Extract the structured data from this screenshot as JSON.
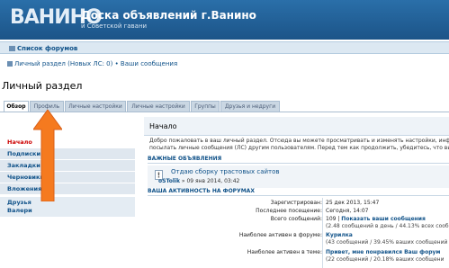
{
  "header": {
    "logo": "ВАНИНО",
    "title": "Доска объявлений г.Ванино",
    "subtitle": "и Советской гавани"
  },
  "navbar": {
    "forum_list": "Список форумов"
  },
  "breadcrumbs": "Личный раздел (Новых ЛС: 0) • Ваши сообщения",
  "page_title": "Личный раздел",
  "tabs": [
    "Обзор",
    "Профиль",
    "Личные настройки",
    "Личные настройки",
    "Группы",
    "Друзья и недруги"
  ],
  "sidebar": {
    "items": [
      "Начало",
      "Подписки",
      "Закладки",
      "Черновики",
      "Вложения"
    ],
    "friends": [
      "Друзья",
      "Валери"
    ]
  },
  "main": {
    "heading": "Начало",
    "intro_1": "Добро пожаловать в ваш личный раздел. Отсюда вы можете просматривать и изменять настройки, инфо",
    "intro_2": "посылать личные сообщения (ЛС) другим пользователям. Перед тем как продолжить, убедитесь, что вы",
    "important_head": "ВАЖНЫЕ ОБЪЯВЛЕНИЯ",
    "announcement": {
      "title": "Отдаю сборку трастовых сайтов",
      "author": "oSTolik",
      "date": "» 09 янв 2014, 03:42"
    },
    "activity_head": "ВАША АКТИВНОСТЬ НА ФОРУМАХ",
    "stats": {
      "registered_label": "Зарегистрирован:",
      "registered_value": "25 дек 2013, 15:47",
      "last_visit_label": "Последнее посещение:",
      "last_visit_value": "Сегодня, 14:07",
      "posts_label": "Всего сообщений:",
      "posts_count": "109",
      "posts_link": "Показать ваши сообщения",
      "posts_sub": "(2.48 сообщений в день / 44.13% всех сооб",
      "active_forum_label": "Наиболее активен в форуме:",
      "active_forum_value": "Курилка",
      "active_forum_sub": "(43 сообщений / 39.45% ваших сообщений",
      "active_topic_label": "Наиболее активен в теме:",
      "active_topic_value": "Привет, мне понравился Ваш форум",
      "active_topic_sub": "(22 сообщений / 20.18% ваших сообщени"
    }
  },
  "colors": {
    "header": "#1c5488",
    "link": "#105289",
    "active": "#cc0000",
    "arrow": "#f57a1f"
  }
}
